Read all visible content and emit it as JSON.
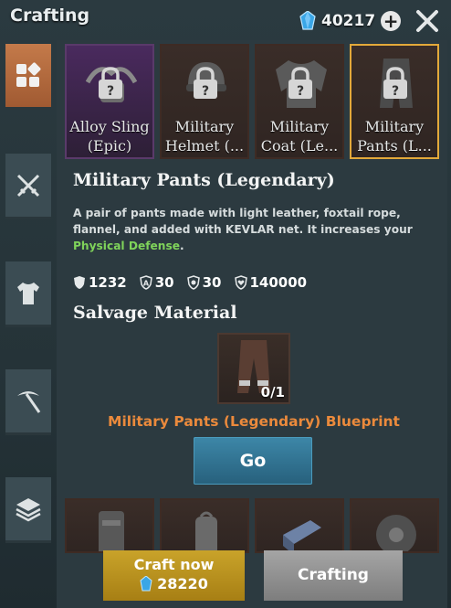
{
  "header": {
    "title": "Crafting",
    "currency_value": "40217",
    "gem_icon": "blue-crystal-icon",
    "plus_icon": "plus-circle-icon",
    "close_icon": "close-x-icon"
  },
  "sidebar": {
    "tabs": [
      {
        "icon": "grid-squares-icon",
        "active": true
      },
      {
        "icon": "crossed-swords-icon",
        "active": false
      },
      {
        "icon": "tshirt-icon",
        "active": false
      },
      {
        "icon": "pickaxe-icon",
        "active": false
      },
      {
        "icon": "layers-icon",
        "active": false
      }
    ]
  },
  "items": [
    {
      "label": "Alloy Sling\n(Epic)",
      "rarity": "epic",
      "icon": "sling-icon",
      "locked": true
    },
    {
      "label": "Military\nHelmet (...",
      "rarity": "legendary",
      "icon": "helmet-icon",
      "locked": true
    },
    {
      "label": "Military\nCoat (Le...",
      "rarity": "legendary",
      "icon": "coat-icon",
      "locked": true
    },
    {
      "label": "Military\nPants (L...",
      "rarity": "legendary",
      "icon": "pants-icon",
      "locked": true,
      "selected": true
    }
  ],
  "detail": {
    "title": "Military Pants (Legendary)",
    "desc_part1": "A pair of pants made with light leather, foxtail rope, flannel, and added with KEVLAR net. It increases your ",
    "desc_highlight": "Physical Defense",
    "desc_part2": ".",
    "stats": [
      {
        "icon": "shield-icon",
        "value": "1232"
      },
      {
        "icon": "armor-a-icon",
        "value": "30"
      },
      {
        "icon": "snowflake-shield-icon",
        "value": "30"
      },
      {
        "icon": "heart-shield-icon",
        "value": "140000"
      }
    ]
  },
  "salvage": {
    "title": "Salvage Material",
    "material_icon": "pants-blueprint-icon",
    "count": "0/1",
    "blueprint_name": "Military Pants (Legendary) Blueprint",
    "go_label": "Go"
  },
  "bottom_items": [
    {
      "icon": "armor-vest-icon"
    },
    {
      "icon": "backpack-icon"
    },
    {
      "icon": "brick-icon"
    },
    {
      "icon": "shield-round-icon"
    }
  ],
  "footer": {
    "craft_label": "Craft now",
    "craft_cost": "28220",
    "crafting_label": "Crafting"
  },
  "colors": {
    "active_tab": "#c47a4a",
    "selected_border": "#e3a93a",
    "highlight_green": "#7fd35a",
    "blueprint_orange": "#eb8a3c",
    "go_button": "#3d87a8",
    "craft_button": "#c9a32a",
    "crafting_button": "#9a9a9a"
  }
}
